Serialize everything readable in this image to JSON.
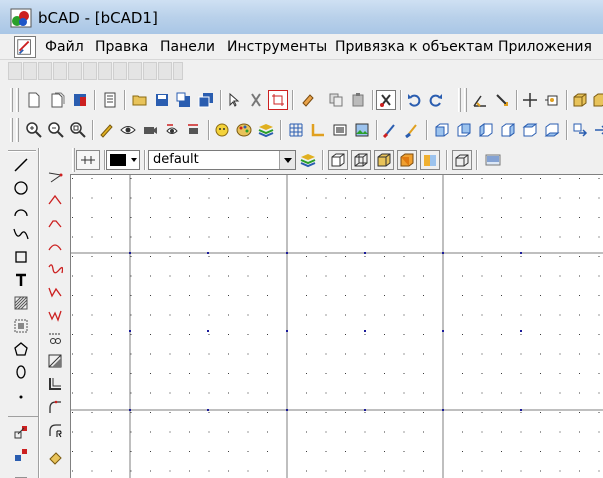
{
  "window": {
    "title": "bCAD - [bCAD1]"
  },
  "menu": {
    "items": [
      "Файл",
      "Правка",
      "Панели",
      "Инструменты",
      "Привязка к объектам",
      "Приложения"
    ]
  },
  "layer_bar": {
    "current_color": "#000000",
    "layer_name": "default"
  },
  "colors": {
    "grid_major": "#7f7f7f",
    "grid_dot": "#3a3a3a",
    "grid_marker": "#1b1b9a",
    "accent_red": "#cc2020",
    "accent_blue": "#2a5db0"
  },
  "icons": {
    "toolbar1": [
      "new-doc-icon",
      "new-template-icon",
      "color-doc-icon",
      "list-icon",
      "open-folder-icon",
      "save-icon",
      "save-as-icon",
      "save-all-icon",
      "select-arrow-icon",
      "cut-icon",
      "crop-icon",
      "eraser-icon",
      "copy-icon",
      "paste-icon",
      "clone-icon",
      "undo-icon",
      "redo-icon",
      "measure-angle-icon",
      "measure-line-icon",
      "crosshair-icon",
      "snap-point-icon",
      "cube-icon"
    ],
    "toolbar2": [
      "zoom-in-icon",
      "zoom-out-icon",
      "zoom-fit-icon",
      "pencil-icon",
      "eye-icon",
      "camera-icon",
      "eye-rotate-icon",
      "camera-rotate-icon",
      "smiley-icon",
      "palette-icon",
      "layers-icon",
      "grid-icon",
      "axes-icon",
      "frame-icon",
      "picture-icon",
      "brush-icon",
      "paint-icon",
      "view-front-icon",
      "view-back-icon",
      "view-left-icon",
      "view-right-icon",
      "view-top-icon",
      "view-bottom-icon",
      "export-icon"
    ],
    "left_col1": [
      "line-tool-icon",
      "circle-tool-icon",
      "arc-tool-icon",
      "spline-tool-icon",
      "rectangle-tool-icon",
      "text-tool-icon",
      "hatch-tool-icon",
      "fill-tool-icon",
      "polygon-tool-icon",
      "ellipse-tool-icon",
      "point-tool-icon",
      "insert-block-icon",
      "explode-block-icon",
      "table-tool-icon"
    ],
    "left_col2": [
      "polyline-icon",
      "angle-icon",
      "chamfer-icon",
      "bend-icon",
      "wave-icon",
      "zigzag-icon",
      "break-icon",
      "cut-edge-icon",
      "rotate-edge-icon",
      "corner-icon",
      "fillet-icon",
      "fillet-radius-icon",
      "paint-bucket-icon"
    ],
    "layer_bar": [
      "layer-stamp-icon",
      "layers-stack-icon",
      "solid-cube-icon",
      "wire-cube-icon",
      "shaded-cube-icon",
      "render-cube-icon",
      "color-cube-icon",
      "box-outline-icon",
      "stripe-icon"
    ]
  }
}
